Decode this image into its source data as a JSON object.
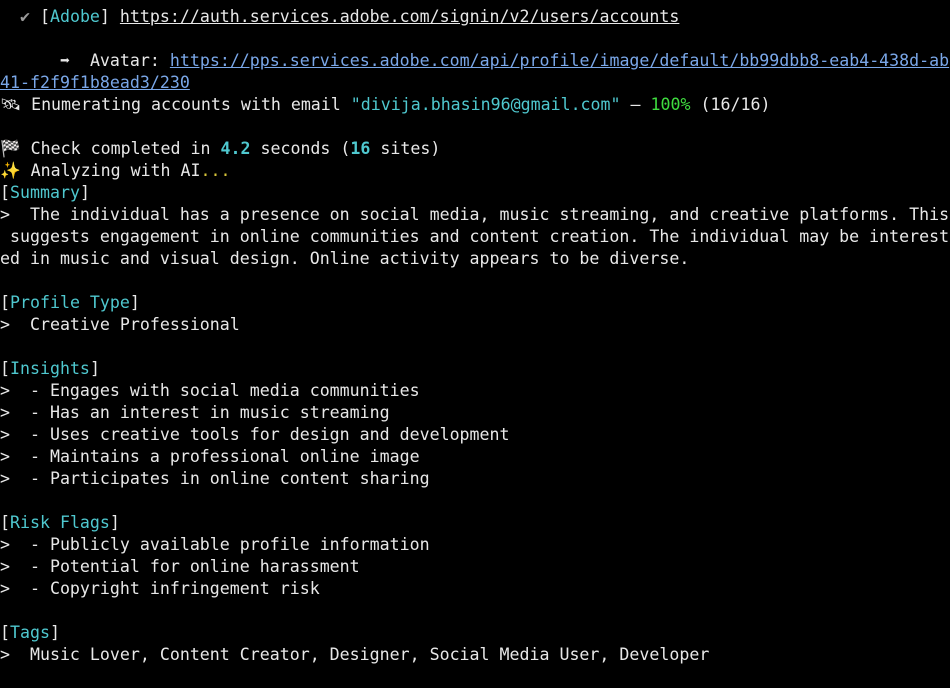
{
  "adobe": {
    "check_icon": "✔",
    "site": "Adobe",
    "url": "https://auth.services.adobe.com/signin/v2/users/accounts"
  },
  "avatar": {
    "arrow": "➡",
    "label": "Avatar:",
    "url_line1": "https://pps.services.adobe.com/api/profile/image/default/bb99dbb8-eab4-438d-ab",
    "url_line2": "41-f2f9f1b8ead3/230"
  },
  "enumerating": {
    "icon": "🛰",
    "text": "Enumerating accounts with email",
    "email": "\"divija.bhasin96@gmail.com\"",
    "dash": "—",
    "percent": "100%",
    "count": "(16/16)"
  },
  "check_completed": {
    "icon": "🏁",
    "text_before": "Check completed in",
    "seconds_value": "4.2",
    "text_middle": "seconds (",
    "sites_value": "16",
    "text_after": "sites)"
  },
  "analyzing": {
    "icon": "✨",
    "text": "Analyzing with AI",
    "dots": "..."
  },
  "summary": {
    "heading": "Summary",
    "lines": [
      ">  The individual has a presence on social media, music streaming, and creative platforms. This",
      " suggests engagement in online communities and content creation. The individual may be interest",
      "ed in music and visual design. Online activity appears to be diverse."
    ]
  },
  "profile_type": {
    "heading": "Profile Type",
    "value": ">  Creative Professional"
  },
  "insights": {
    "heading": "Insights",
    "items": [
      ">  - Engages with social media communities",
      ">  - Has an interest in music streaming",
      ">  - Uses creative tools for design and development",
      ">  - Maintains a professional online image",
      ">  - Participates in online content sharing"
    ]
  },
  "risk_flags": {
    "heading": "Risk Flags",
    "items": [
      ">  - Publicly available profile information",
      ">  - Potential for online harassment",
      ">  - Copyright infringement risk"
    ]
  },
  "tags": {
    "heading": "Tags",
    "value": ">  Music Lover, Content Creator, Designer, Social Media User, Developer"
  },
  "colors": {
    "background": "#000000",
    "text": "#e8e8e8",
    "accent_cyan": "#4fc8cf",
    "progress_green": "#3fdc3f",
    "dots_yellow": "#d7c43a",
    "link_blue": "#7aa7e8"
  }
}
